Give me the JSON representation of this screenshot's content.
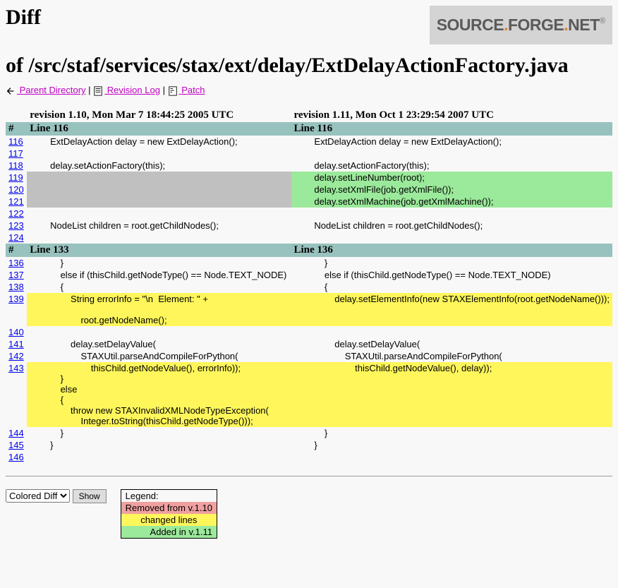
{
  "logo": {
    "left": "SOURCE",
    "right": "FORGE",
    "suffix": "NET"
  },
  "title_line1": "Diff",
  "title_line2": "of /src/staf/services/stax/ext/delay/ExtDelayActionFactory.java",
  "nav": {
    "parent": " Parent Directory",
    "revlog": " Revision Log",
    "patch": " Patch",
    "sep": " | "
  },
  "headers": {
    "left": "revision 1.10, Mon Mar 7 18:44:25 2005 UTC",
    "right": "revision 1.11, Mon Oct 1 23:29:54 2007 UTC"
  },
  "hash": "#",
  "hunk1": {
    "left": "Line 116",
    "right": "Line 116"
  },
  "hunk2": {
    "left": "Line 133",
    "right": "Line 136"
  },
  "rows": [
    {
      "n": "116",
      "l": "        ExtDelayAction delay = new ExtDelayAction();",
      "r": "        ExtDelayAction delay = new ExtDelayAction();",
      "cls": ""
    },
    {
      "n": "117",
      "l": "",
      "r": "",
      "cls": ""
    },
    {
      "n": "118",
      "l": "        delay.setActionFactory(this);",
      "r": "        delay.setActionFactory(this);",
      "cls": ""
    },
    {
      "n": "119",
      "l": "",
      "r": "        delay.setLineNumber(root);",
      "cls": "add"
    },
    {
      "n": "120",
      "l": "",
      "r": "        delay.setXmlFile(job.getXmlFile());",
      "cls": "add"
    },
    {
      "n": "121",
      "l": "",
      "r": "        delay.setXmlMachine(job.getXmlMachine());",
      "cls": "add"
    },
    {
      "n": "122",
      "l": "",
      "r": "",
      "cls": ""
    },
    {
      "n": "123",
      "l": "        NodeList children = root.getChildNodes();",
      "r": "        NodeList children = root.getChildNodes();",
      "cls": ""
    },
    {
      "n": "124",
      "l": "",
      "r": "",
      "cls": ""
    }
  ],
  "rows2a": [
    {
      "n": "136",
      "l": "            }",
      "r": "            }",
      "cls": ""
    },
    {
      "n": "137",
      "l": "            else if (thisChild.getNodeType() == Node.TEXT_NODE)",
      "r": "            else if (thisChild.getNodeType() == Node.TEXT_NODE)",
      "cls": ""
    },
    {
      "n": "138",
      "l": "            {",
      "r": "            {",
      "cls": ""
    }
  ],
  "row139": {
    "n": "139",
    "l": "                String errorInfo = \"\\n  Element: \" +\n\n                    root.getNodeName();",
    "r": "                delay.setElementInfo(new STAXElementInfo(root.getNodeName()));"
  },
  "rows2b": [
    {
      "n": "140",
      "l": "",
      "r": "",
      "cls": ""
    },
    {
      "n": "141",
      "l": "                delay.setDelayValue(",
      "r": "                delay.setDelayValue(",
      "cls": ""
    },
    {
      "n": "142",
      "l": "                    STAXUtil.parseAndCompileForPython(",
      "r": "                    STAXUtil.parseAndCompileForPython(",
      "cls": ""
    }
  ],
  "row143": {
    "n": "143",
    "l": "                        thisChild.getNodeValue(), errorInfo));\n            }\n            else\n            {\n                throw new STAXInvalidXMLNodeTypeException(\n                    Integer.toString(thisChild.getNodeType()));",
    "r": "                        thisChild.getNodeValue(), delay));"
  },
  "rows2c": [
    {
      "n": "144",
      "l": "            }",
      "r": "            }",
      "cls": ""
    },
    {
      "n": "145",
      "l": "        }",
      "r": "        }",
      "cls": ""
    },
    {
      "n": "146",
      "l": "",
      "r": "",
      "cls": ""
    }
  ],
  "controls": {
    "diff_type": "Colored Diff",
    "show": "Show"
  },
  "legend": {
    "title": "Legend:",
    "removed": "Removed from v.1.10",
    "changed": "changed lines",
    "added": "Added in v.1.11"
  }
}
